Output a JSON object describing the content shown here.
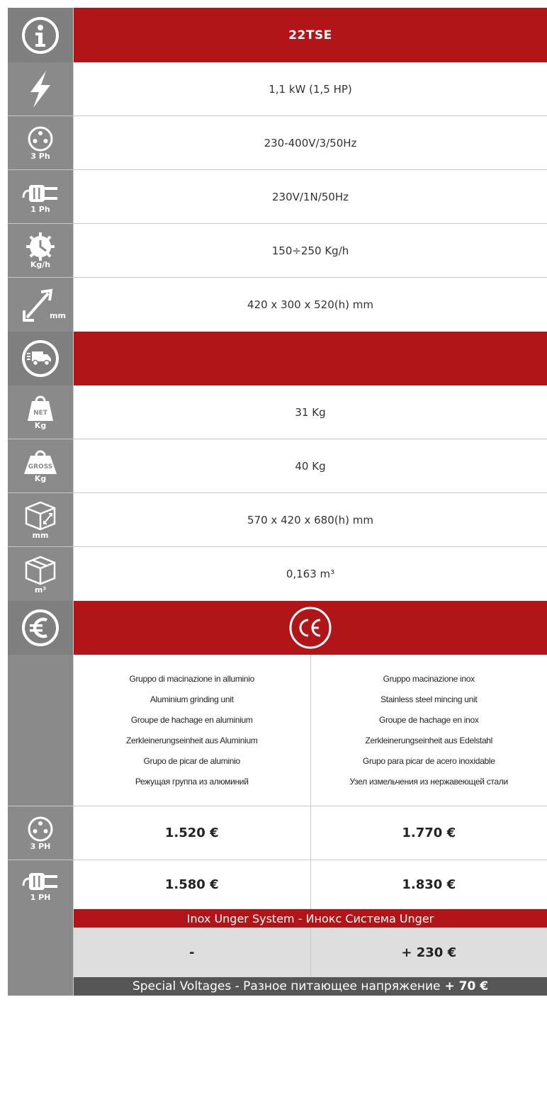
{
  "header": {
    "title": "22TSE"
  },
  "specs": {
    "power": "1,1 kW (1,5 HP)",
    "three_phase_label": "3 Ph",
    "three_phase": "230-400V/3/50Hz",
    "single_phase_label": "1 Ph",
    "single_phase": "230V/1N/50Hz",
    "capacity_label": "Kg/h",
    "capacity": "150÷250 Kg/h",
    "dimensions_label": "mm",
    "dimensions": "420 x 300 x 520(h) mm"
  },
  "shipping": {
    "net_badge": "NET",
    "net_label": "Kg",
    "net_weight": "31 Kg",
    "gross_badge": "GROSS",
    "gross_label": "Kg",
    "gross_weight": "40 Kg",
    "package_label": "mm",
    "package_dimensions": "570 x 420 x 680(h) mm",
    "volume_label": "m³",
    "volume": "0,163 m³"
  },
  "versions": [
    {
      "description": [
        "Gruppo di macinazione in alluminio",
        "Aluminium grinding unit",
        "Groupe de hachage en aluminium",
        "Zerkleinerungseinheit aus Aluminium",
        "Grupo de picar de aluminio",
        "Режущая группа из алюминий"
      ],
      "price_3ph": "1.520 €",
      "price_1ph": "1.580 €",
      "unger": "-"
    },
    {
      "description": [
        "Gruppo macinazione inox",
        "Stainless steel mincing unit",
        "Groupe de hachage en inox",
        "Zerkleinerungseinheit aus Edelstahl",
        "Grupo para picar de acero inoxidable",
        "Узел измельчения из нержавеющей стали"
      ],
      "price_3ph": "1.770 €",
      "price_1ph": "1.830 €",
      "unger": "+ 230 €"
    }
  ],
  "prices": {
    "label_3ph": "3 PH",
    "label_1ph": "1 PH"
  },
  "unger_banner": "Inox Unger System - Инокс Система Unger",
  "special_voltages": {
    "text": "Special Voltages - Разное питающее напряжение",
    "price": "+ 70 €"
  },
  "colors": {
    "accent_red": "#b11518",
    "icon_grey": "#8a8a8a",
    "light_grey": "#dedede",
    "dark_grey": "#555555"
  },
  "icons": [
    "info-icon",
    "lightning-icon",
    "three-phase-plug-icon",
    "single-phase-plug-icon",
    "gear-clock-icon",
    "diagonal-dimension-icon",
    "delivery-truck-icon",
    "net-weight-icon",
    "gross-weight-icon",
    "package-dimension-icon",
    "package-volume-icon",
    "euro-icon",
    "ce-mark-icon"
  ]
}
